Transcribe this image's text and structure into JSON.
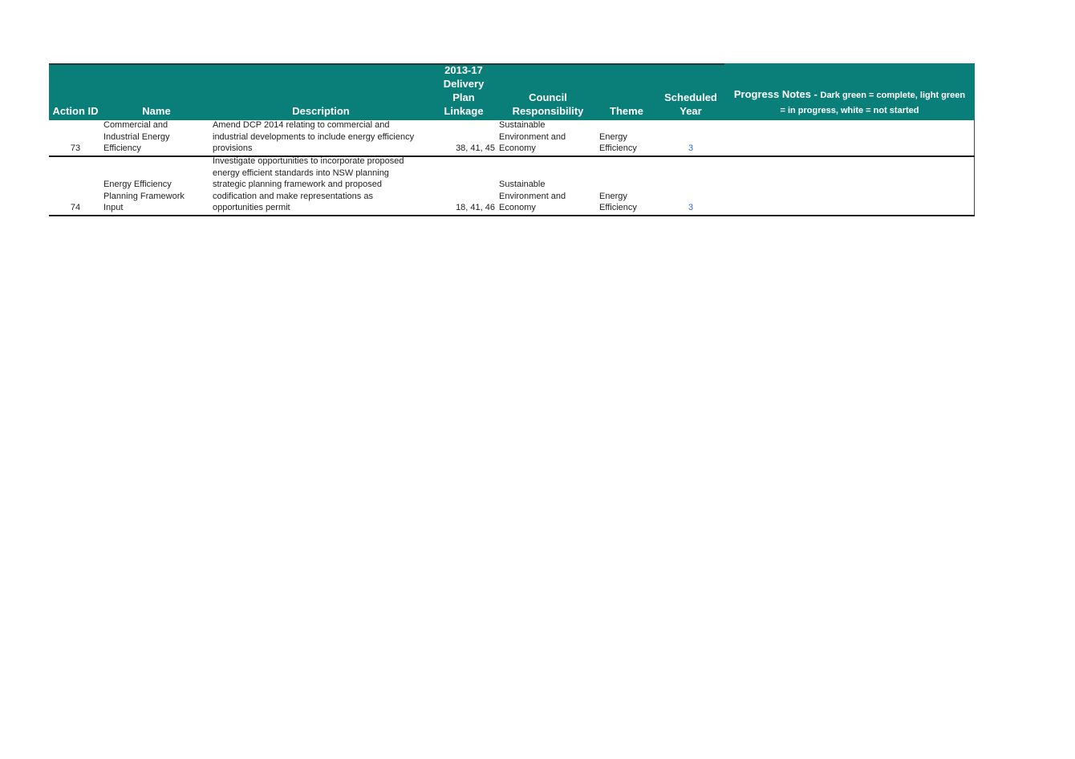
{
  "colors": {
    "header_bg": "#0a7f7a",
    "year_text": "#2e6fd6"
  },
  "header": {
    "action_id": "Action ID",
    "name": "Name",
    "description": "Description",
    "linkage": "2013-17\nDelivery\nPlan\nLinkage",
    "responsibility": "Council\nResponsibility",
    "theme": "Theme",
    "scheduled_year": "Scheduled\nYear",
    "notes_title": "Progress Notes - ",
    "notes_sub": "Dark green = complete, light green\n= in progress, white = not started"
  },
  "rows": [
    {
      "id": "73",
      "name": "Commercial and\nIndustrial Energy\nEfficiency",
      "description": "Amend DCP 2014 relating to commercial and\nindustrial developments to include energy efficiency\nprovisions",
      "linkage": "38, 41, 45",
      "responsibility": "Sustainable\nEnvironment and\nEconomy",
      "theme": "Energy\nEfficiency",
      "year": "3",
      "notes": ""
    },
    {
      "id": "74",
      "name": "Energy Efficiency\nPlanning Framework\nInput",
      "description": "Investigate opportunities to incorporate proposed\nenergy efficient standards into NSW planning\nstrategic planning framework and proposed\ncodification and make representations as\nopportunities permit",
      "linkage": "18, 41, 46",
      "responsibility": "Sustainable\nEnvironment and\nEconomy",
      "theme": "Energy\nEfficiency",
      "year": "3",
      "notes": ""
    }
  ]
}
